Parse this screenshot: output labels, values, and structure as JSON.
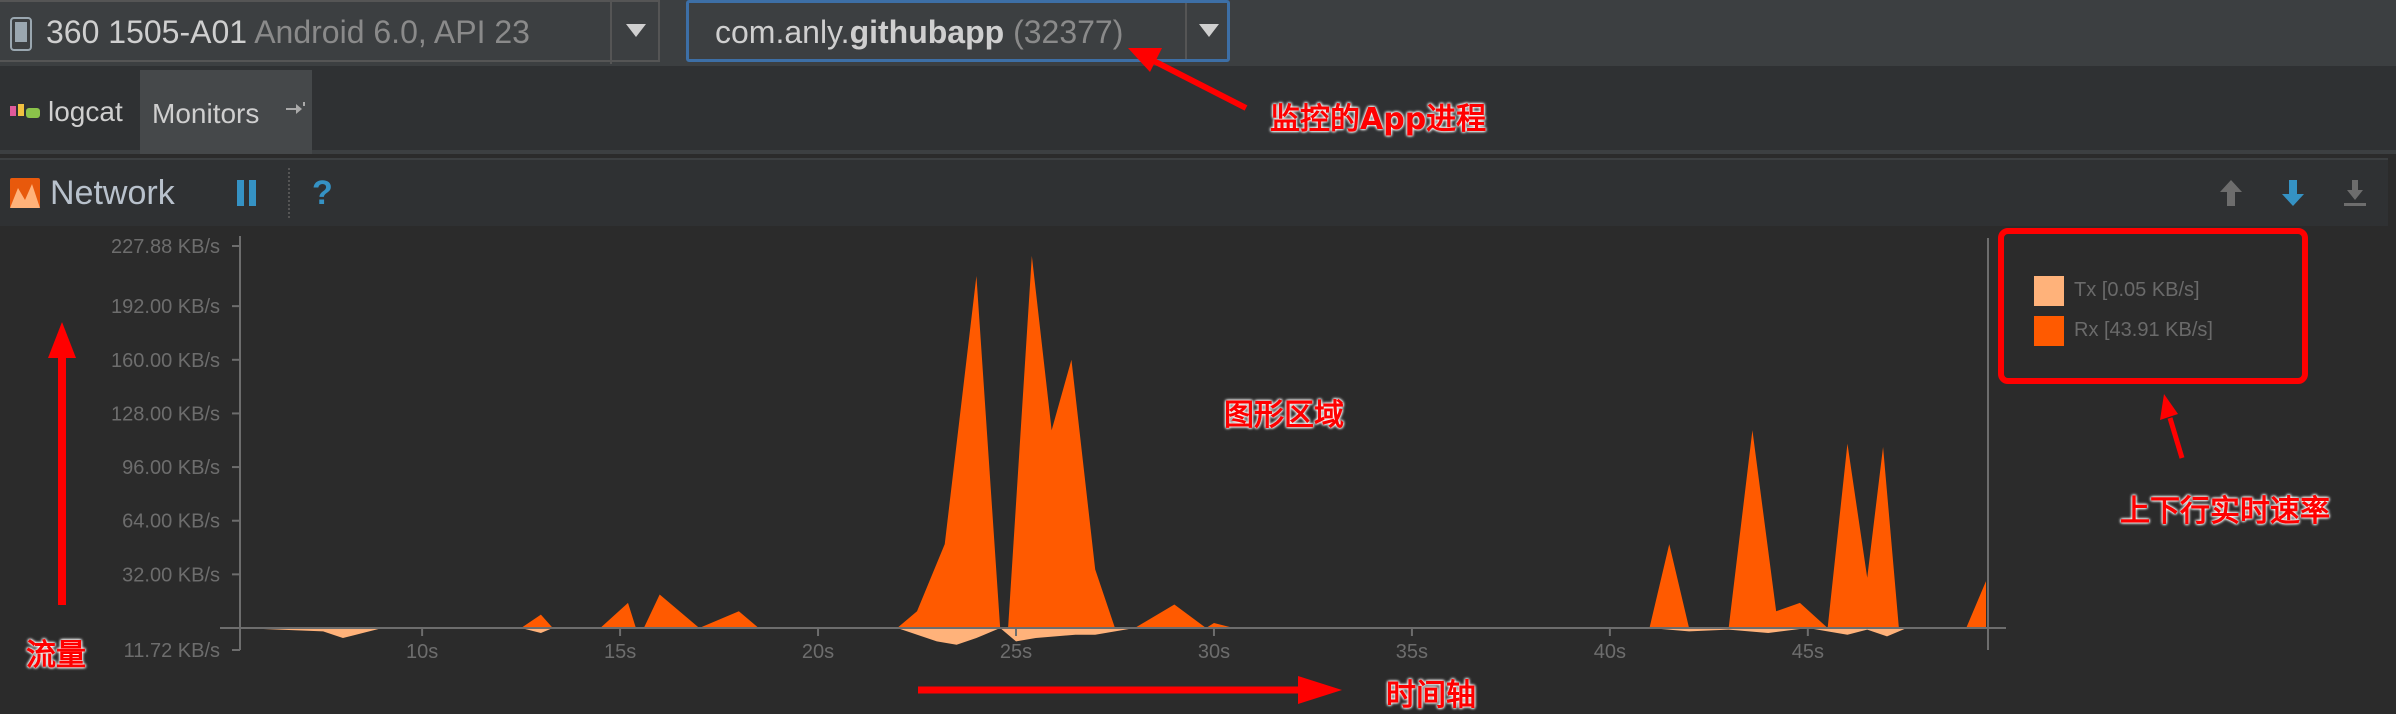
{
  "toolbar": {
    "device_name": "360 1505-A01",
    "device_os": "Android 6.0, API 23",
    "process_prefix": "com.anly.",
    "process_bold": "githubapp",
    "process_pid": "(32377)"
  },
  "tabs": {
    "logcat": "logcat",
    "monitors": "Monitors"
  },
  "monitor": {
    "title": "Network"
  },
  "legend": {
    "tx": "Tx [0.05 KB/s]",
    "rx": "Rx [43.91 KB/s]"
  },
  "annotations": {
    "process": "监控的App进程",
    "chart_area": "图形区域",
    "rates": "上下行实时速率",
    "traffic": "流量",
    "time_axis": "时间轴"
  },
  "colors": {
    "rx": "#ff5a00",
    "tx": "#ffb27a",
    "annotation": "#ff0000",
    "accent": "#3d6fa6"
  },
  "chart_data": {
    "type": "area",
    "y_ticks": [
      "227.88 KB/s",
      "192.00 KB/s",
      "160.00 KB/s",
      "128.00 KB/s",
      "96.00 KB/s",
      "64.00 KB/s",
      "32.00 KB/s",
      "11.72 KB/s"
    ],
    "y_tick_values": [
      227.88,
      192,
      160,
      128,
      96,
      64,
      32,
      0
    ],
    "x_ticks": [
      "10s",
      "15s",
      "20s",
      "25s",
      "30s",
      "35s",
      "40s",
      "45s"
    ],
    "x_tick_values": [
      10,
      15,
      20,
      25,
      30,
      35,
      40,
      45
    ],
    "xlim": [
      5.4,
      49.5
    ],
    "ylim": [
      -11.72,
      227.88
    ],
    "series": [
      {
        "name": "Rx",
        "x": [
          5.4,
          12.5,
          13.0,
          13.3,
          14.5,
          15.2,
          15.4,
          15.6,
          16.0,
          17.0,
          18.0,
          18.5,
          19.5,
          22.0,
          22.5,
          23.2,
          24.0,
          24.6,
          24.8,
          25.4,
          25.9,
          26.4,
          27.0,
          27.5,
          28.0,
          29.0,
          29.8,
          30.0,
          30.5,
          31.5,
          41.0,
          41.5,
          42.0,
          43.0,
          43.6,
          44.2,
          44.8,
          45.5,
          46.0,
          46.5,
          46.9,
          47.3,
          48.0,
          49.0,
          49.5
        ],
        "y": [
          0,
          0,
          8,
          0,
          0,
          15,
          0,
          0,
          20,
          0,
          10,
          0,
          0,
          0,
          10,
          50,
          210,
          0,
          0,
          222,
          118,
          160,
          35,
          0,
          0,
          14,
          0,
          3,
          0,
          0,
          0,
          50,
          0,
          0,
          118,
          10,
          15,
          0,
          110,
          30,
          108,
          0,
          0,
          0,
          28
        ]
      },
      {
        "name": "Tx",
        "x": [
          5.4,
          7.5,
          8.0,
          8.5,
          9.0,
          12.5,
          13.0,
          13.3,
          22.0,
          23.0,
          23.5,
          24.0,
          24.6,
          25.0,
          25.5,
          26.5,
          27.0,
          27.5,
          28.0,
          41.0,
          42.0,
          43.0,
          44.0,
          45.0,
          45.5,
          46.0,
          46.5,
          47.0,
          47.5,
          49.5
        ],
        "y": [
          0,
          -2,
          -6,
          -3,
          0,
          0,
          -3,
          0,
          0,
          -8,
          -10,
          -6,
          0,
          -8,
          -6,
          -4,
          -4,
          -2,
          0,
          0,
          -2,
          -1,
          -3,
          0,
          -2,
          -4,
          -1,
          -5,
          0,
          0
        ]
      }
    ]
  }
}
